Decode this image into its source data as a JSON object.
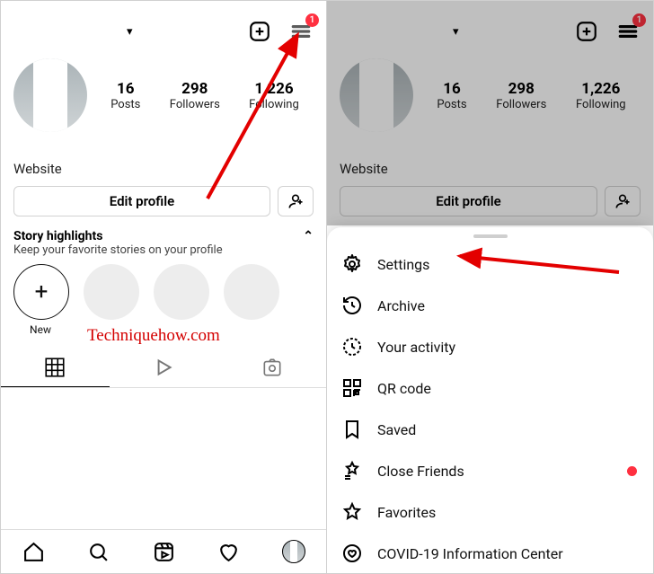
{
  "badge_count": "1",
  "stats": {
    "posts": {
      "count": "16",
      "label": "Posts"
    },
    "followers": {
      "count": "298",
      "label": "Followers"
    },
    "following": {
      "count": "1,226",
      "label": "Following"
    }
  },
  "bio": {
    "website_label": "Website"
  },
  "buttons": {
    "edit_profile": "Edit profile"
  },
  "highlights": {
    "title": "Story highlights",
    "subtitle": "Keep your favorite stories on your profile",
    "new_label": "New"
  },
  "menu": {
    "settings": "Settings",
    "archive": "Archive",
    "activity": "Your activity",
    "qr": "QR code",
    "saved": "Saved",
    "close_friends": "Close Friends",
    "favorites": "Favorites",
    "covid": "COVID-19 Information Center"
  },
  "watermark": "Techniquehow.com"
}
